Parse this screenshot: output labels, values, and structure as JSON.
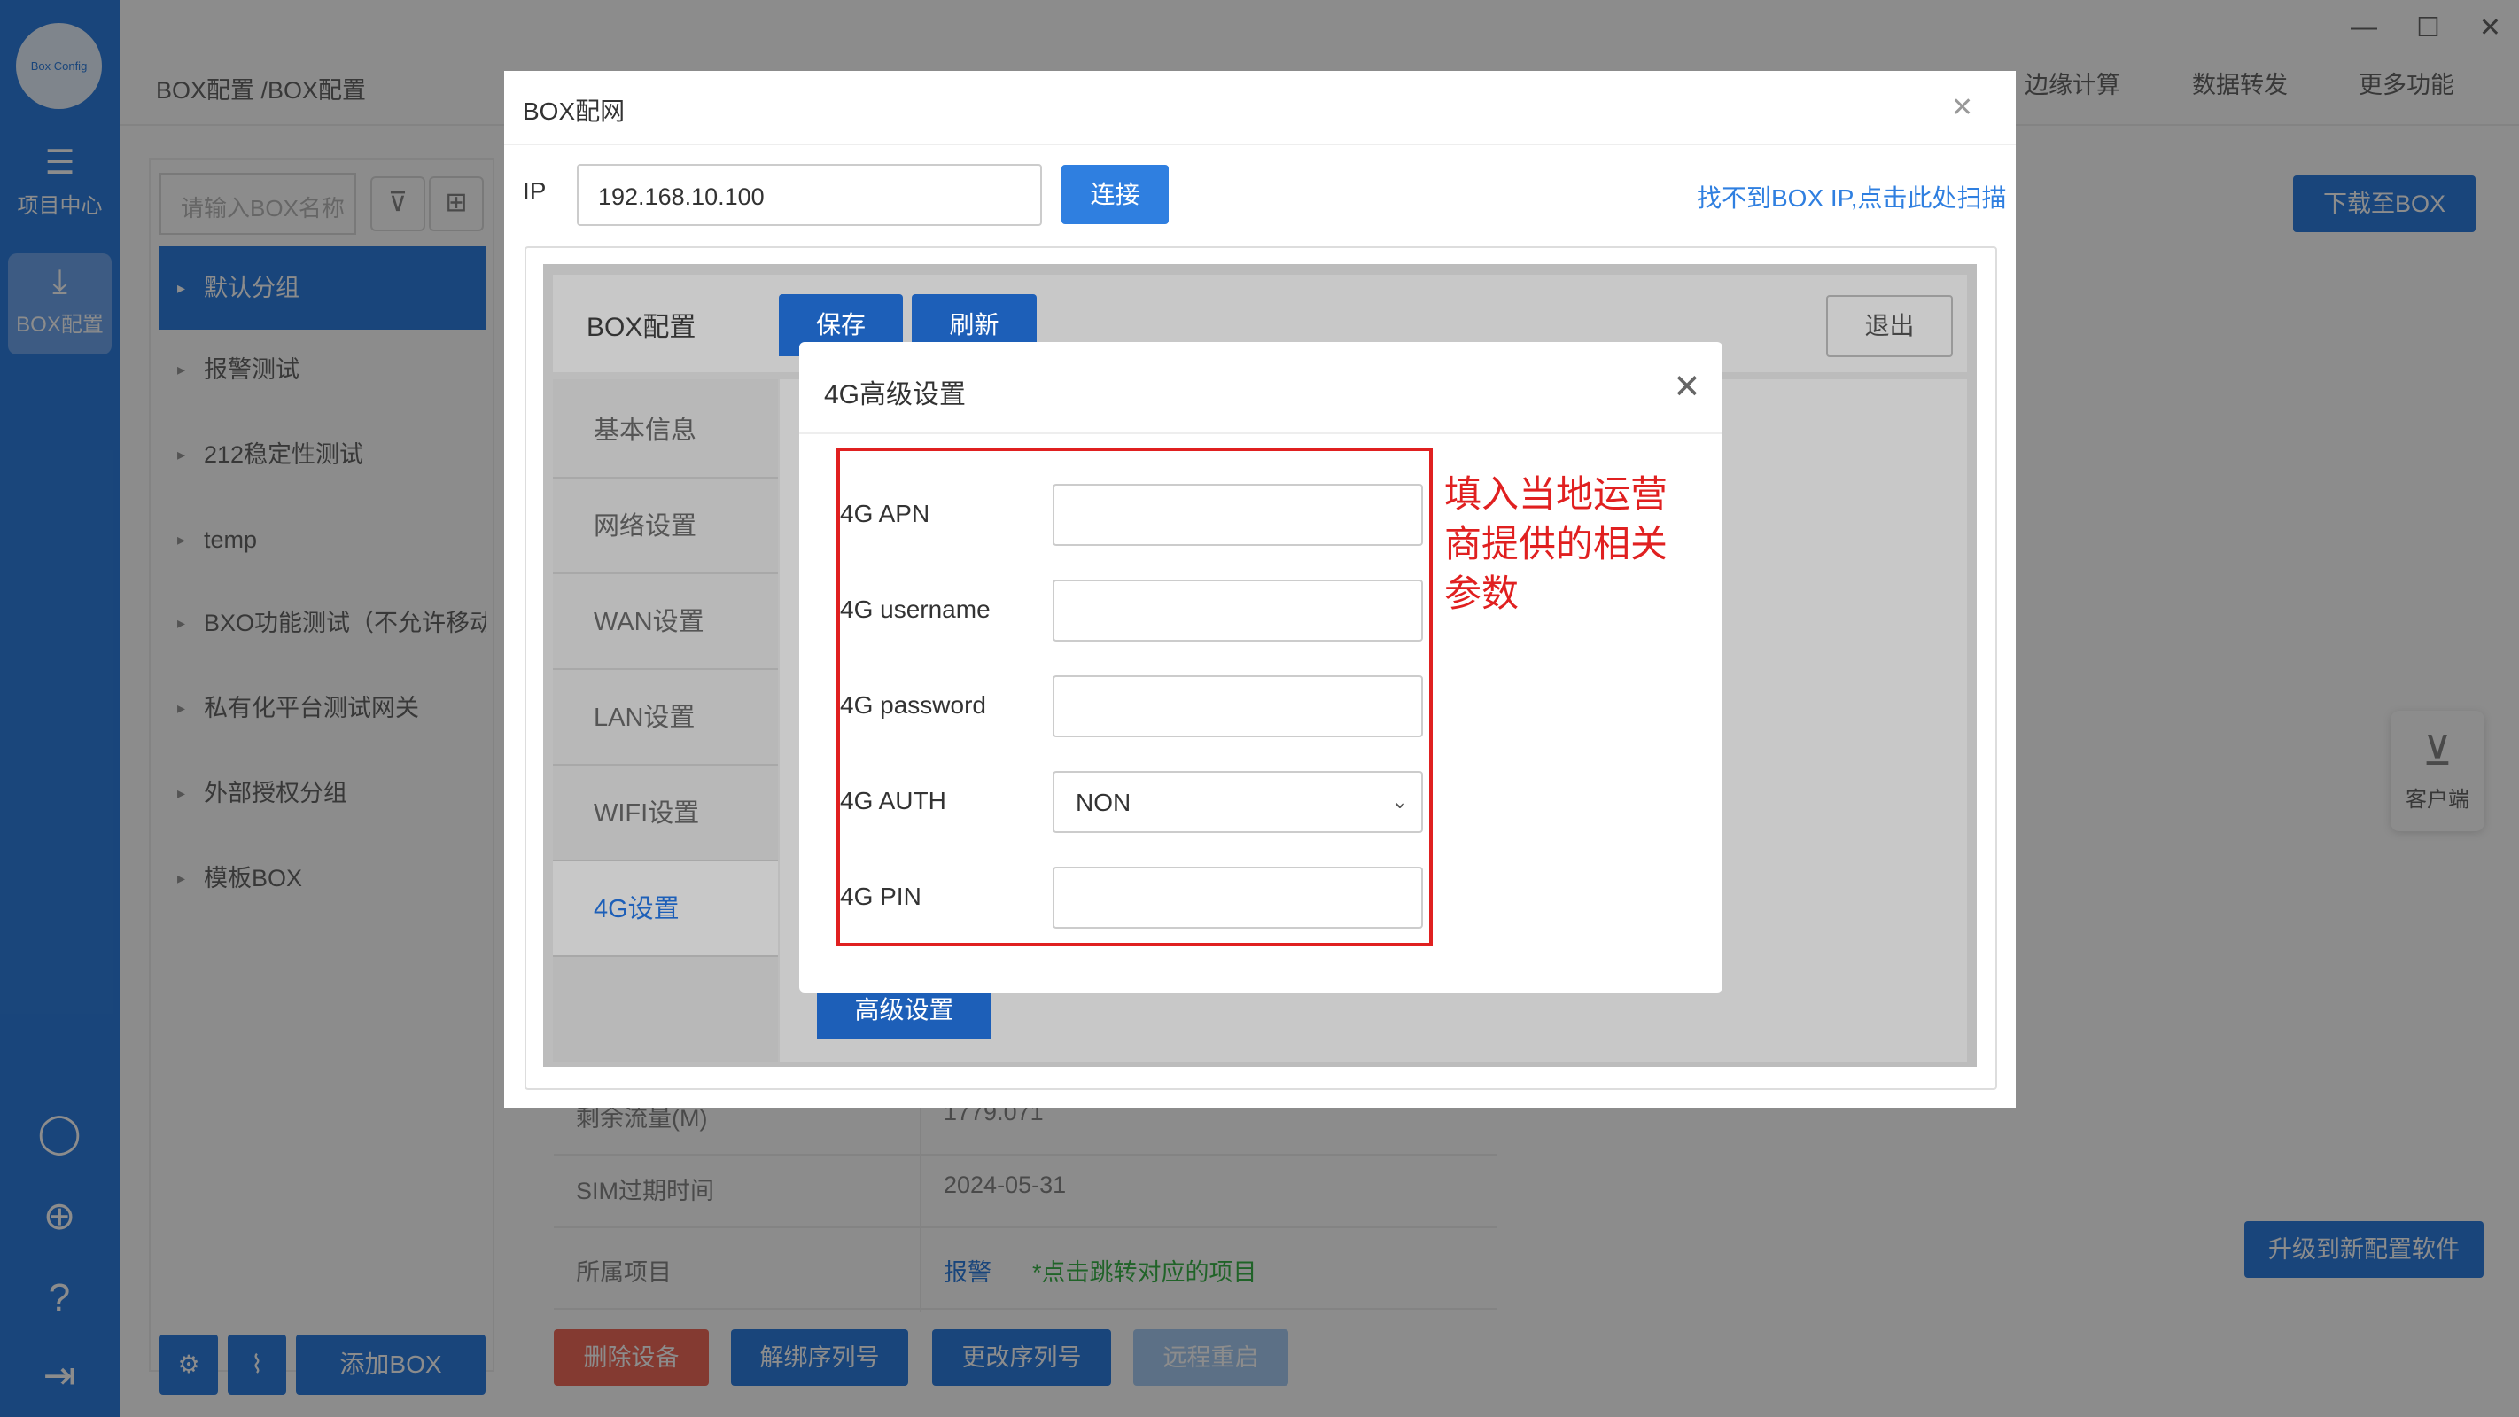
{
  "rail": {
    "logo_text": "Box Config",
    "items": [
      {
        "label": "项目中心",
        "icon": "list-icon"
      },
      {
        "label": "BOX配置",
        "icon": "download-icon"
      }
    ]
  },
  "window": {
    "min": "—",
    "max": "☐",
    "close": "✕"
  },
  "breadcrumb": "BOX配置 /BOX配置",
  "top_menu": [
    "边缘计算",
    "数据转发",
    "更多功能"
  ],
  "sidebar": {
    "search_placeholder": "请输入BOX名称",
    "groups": [
      "默认分组",
      "报警测试",
      "212稳定性测试",
      "temp",
      "BXO功能测试（不允许移动）",
      "私有化平台测试网关",
      "外部授权分组",
      "模板BOX"
    ],
    "add_box": "添加BOX"
  },
  "right": {
    "download_to_box": "下载至BOX",
    "client": "客户端",
    "upgrade": "升级到新配置软件"
  },
  "info": {
    "rows": [
      {
        "k": "剩余流量(M)",
        "v": "1779.071"
      },
      {
        "k": "SIM过期时间",
        "v": "2024-05-31"
      },
      {
        "k": "所属项目",
        "v": "报警",
        "hint": "*点击跳转对应的项目"
      }
    ]
  },
  "actions": [
    "删除设备",
    "解绑序列号",
    "更改序列号",
    "远程重启"
  ],
  "colors": {
    "primary": "#2f7fe0",
    "danger": "#f06b5a",
    "disabled": "#a8cdf5",
    "annotation": "#e02020"
  },
  "dialog_net": {
    "title": "BOX配网",
    "ip_label": "IP",
    "ip_value": "192.168.10.100",
    "connect": "连接",
    "scan_link": "找不到BOX IP,点击此处扫描"
  },
  "box_page": {
    "title": "BOX配置",
    "save": "保存",
    "refresh": "刷新",
    "exit": "退出",
    "nav": [
      "基本信息",
      "网络设置",
      "WAN设置",
      "LAN设置",
      "WIFI设置",
      "4G设置"
    ],
    "advanced": "高级设置"
  },
  "dialog_4g": {
    "title": "4G高级设置",
    "fields": [
      {
        "label": "4G APN",
        "value": ""
      },
      {
        "label": "4G username",
        "value": ""
      },
      {
        "label": "4G password",
        "value": ""
      },
      {
        "label": "4G AUTH",
        "value": "NON"
      },
      {
        "label": "4G PIN",
        "value": ""
      }
    ],
    "note": "填入当地运营商提供的相关参数"
  }
}
